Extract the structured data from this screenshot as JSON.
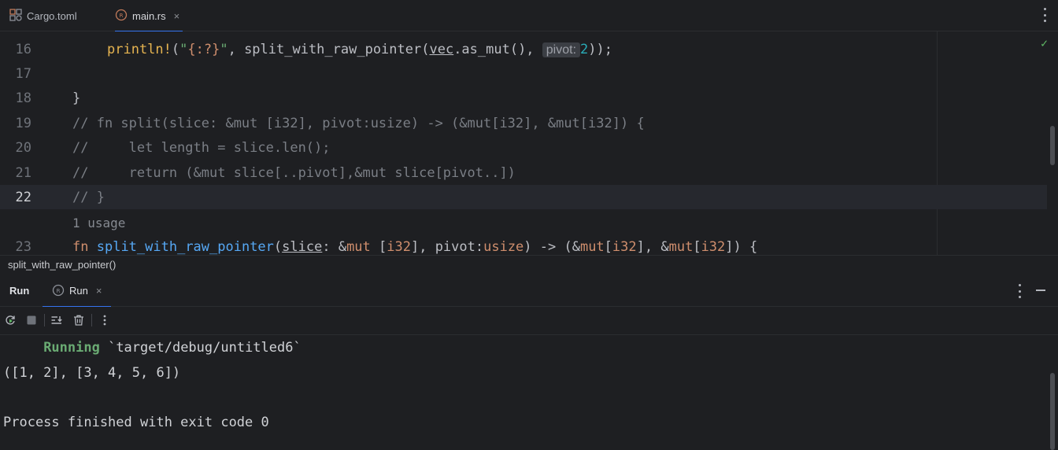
{
  "tabs": [
    {
      "label": "Cargo.toml",
      "icon": "cargo-toml-icon",
      "active": false
    },
    {
      "label": "main.rs",
      "icon": "rust-file-icon",
      "active": true,
      "close": "×"
    }
  ],
  "editor": {
    "lines": [
      {
        "num": "16"
      },
      {
        "num": "17"
      },
      {
        "num": "18"
      },
      {
        "num": "19"
      },
      {
        "num": "20"
      },
      {
        "num": "21"
      },
      {
        "num": "22",
        "current": true
      },
      {
        "num": "23"
      }
    ],
    "code": {
      "l16_macro": "println!",
      "l16_open": "(",
      "l16_str_open": "\"",
      "l16_fmt": "{:?}",
      "l16_str_close": "\"",
      "l16_mid": ", split_with_raw_pointer(",
      "l16_vec": "vec",
      "l16_rest": ".as_mut(), ",
      "l16_hint": "pivot:",
      "l16_num": "2",
      "l16_end": "));",
      "l18": "}",
      "l19": "// fn split(slice: &mut [i32], pivot:usize) -> (&mut[i32], &mut[i32]) {",
      "l20": "//     let length = slice.len();",
      "l21": "//     return (&mut slice[..pivot],&mut slice[pivot..])",
      "l22": "// }",
      "l23_fn": "fn",
      "l23_name": "split_with_raw_pointer",
      "l23_p1": "(",
      "l23_slice": "slice",
      "l23_p2": ": &",
      "l23_mut1": "mut",
      "l23_p3": " [",
      "l23_i32a": "i32",
      "l23_p4": "], pivot:",
      "l23_usize": "usize",
      "l23_p5": ") -> (&",
      "l23_mut2": "mut",
      "l23_p6": "[",
      "l23_i32b": "i32",
      "l23_p7": "], &",
      "l23_mut3": "mut",
      "l23_p8": "[",
      "l23_i32c": "i32",
      "l23_p9": "]) {"
    },
    "usage_hint": "1 usage",
    "status_ok": "✓"
  },
  "breadcrumb": "split_with_raw_pointer()",
  "run_panel": {
    "title": "Run",
    "tab_label": "Run",
    "tab_close": "×",
    "toolbar": [
      "rerun-icon",
      "stop-icon",
      "scroll-to-end-icon",
      "clear-icon",
      "more-icon"
    ]
  },
  "console": {
    "running_label": "Running",
    "running_path": " `target/debug/untitled6`",
    "output": "([1, 2], [3, 4, 5, 6])",
    "exit": "Process finished with exit code 0"
  },
  "colors": {
    "accent": "#3574f0",
    "macro": "#e6b450",
    "string": "#6aab73",
    "keyword": "#cf8e6d",
    "function": "#56a8f5",
    "number": "#2aacb8",
    "comment": "#7a7e85"
  }
}
